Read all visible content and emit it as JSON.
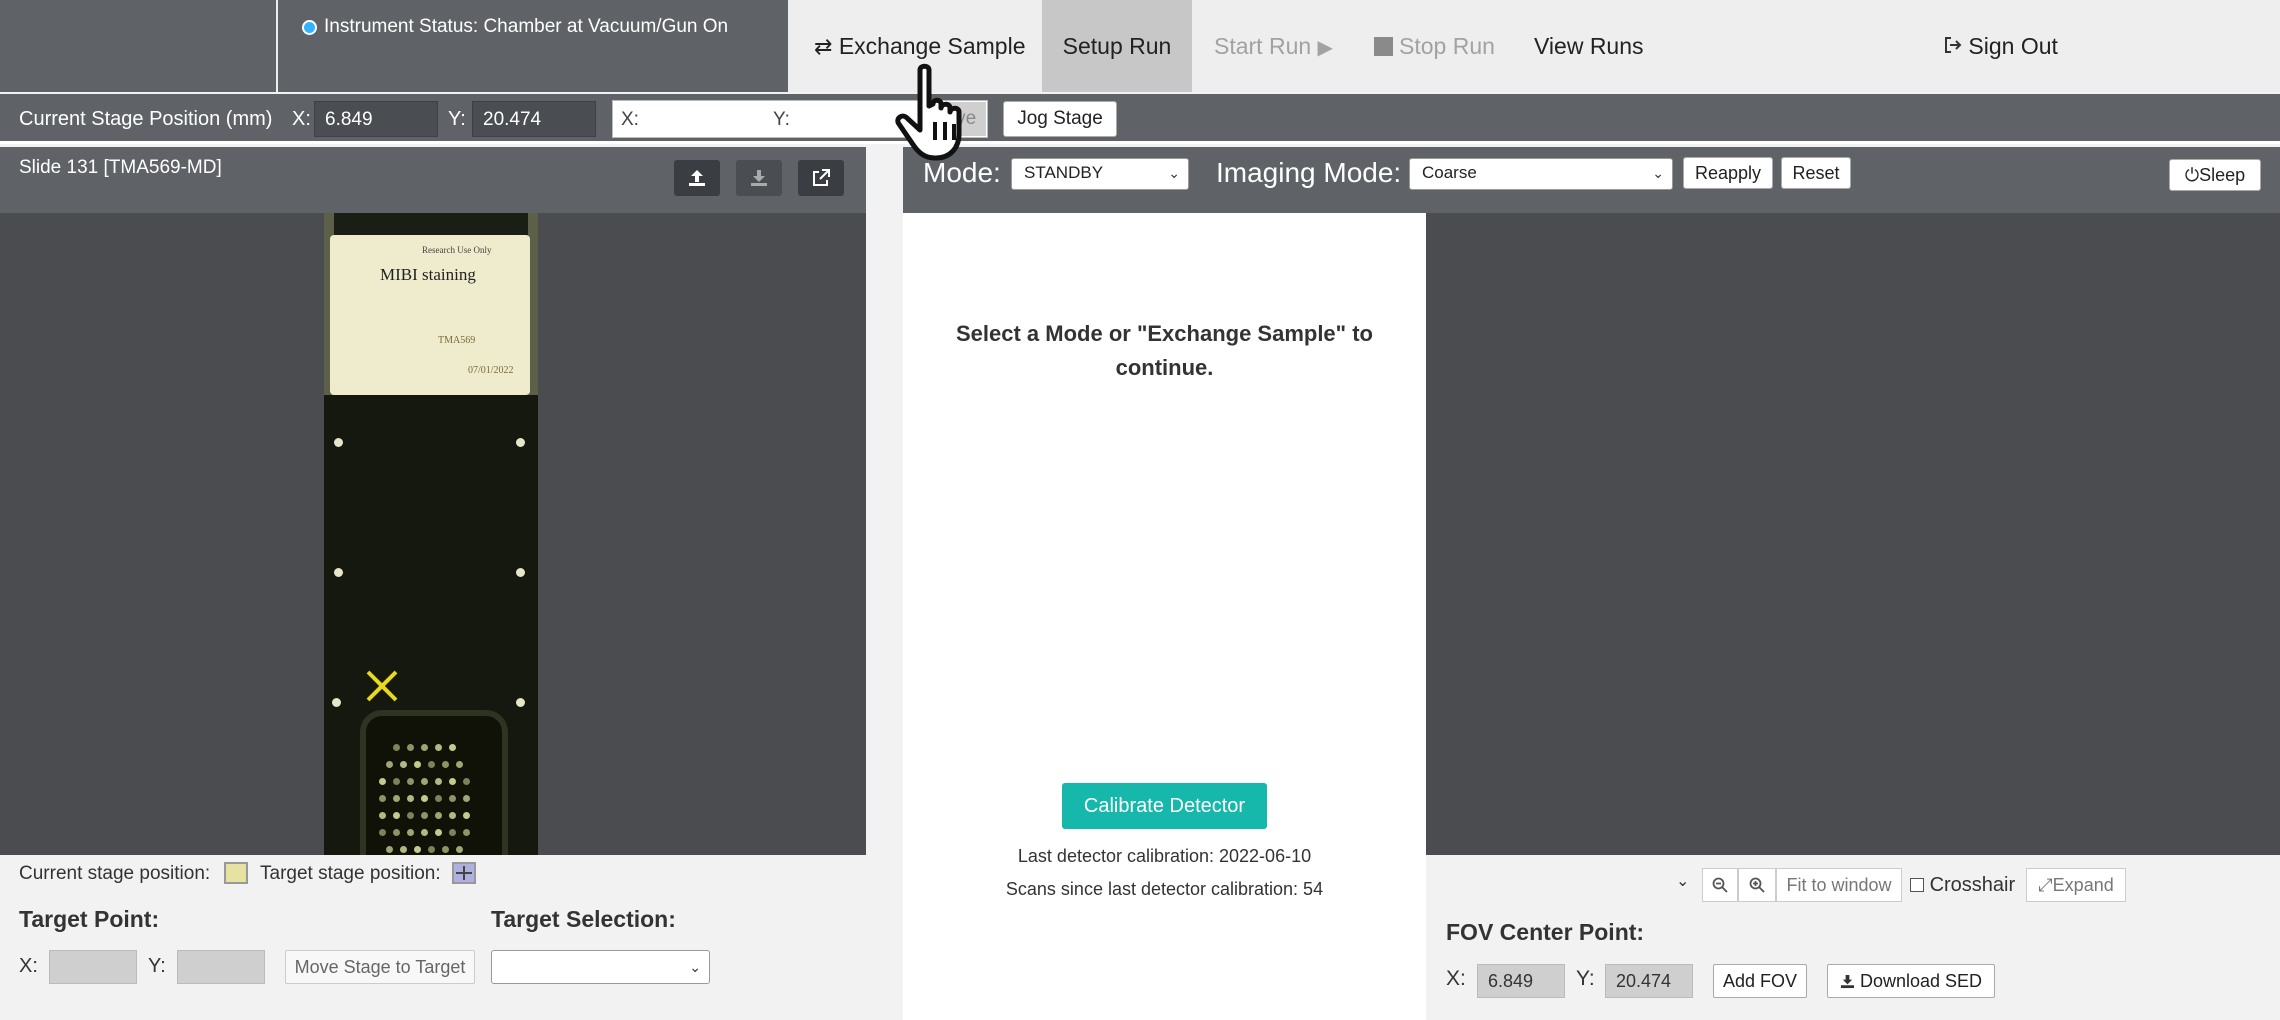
{
  "status": {
    "text": "Instrument Status: Chamber at Vacuum/Gun On",
    "indicator_color": "#32b3ff"
  },
  "nav": {
    "exchange_sample": "Exchange Sample",
    "setup_run": "Setup Run",
    "start_run": "Start Run",
    "stop_run": "Stop Run",
    "view_runs": "View Runs",
    "sign_out": "Sign Out"
  },
  "stage": {
    "label": "Current Stage Position (mm)",
    "x_label": "X:",
    "y_label": "Y:",
    "x_value": "6.849",
    "y_value": "20.474",
    "target_x_label": "X:",
    "target_y_label": "Y:",
    "move_label": "Move",
    "jog_label": "Jog Stage"
  },
  "slide_panel": {
    "title": "Slide 131 [TMA569-MD]",
    "photo_text": {
      "research": "Research Use Only",
      "heading": "MIBI staining",
      "code": "TMA569",
      "date": "07/01/2022"
    },
    "legend_current": "Current stage position:",
    "legend_target": "Target stage position:",
    "target_point_heading": "Target Point:",
    "target_x_label": "X:",
    "target_y_label": "Y:",
    "move_to_target": "Move Stage to Target",
    "target_selection_heading": "Target Selection:",
    "target_selection_value": ""
  },
  "mode_bar": {
    "mode_label": "Mode:",
    "mode_value": "STANDBY",
    "imaging_label": "Imaging Mode:",
    "imaging_value": "Coarse",
    "reapply": "Reapply",
    "reset": "Reset",
    "sleep": "Sleep"
  },
  "center": {
    "message": "Select a Mode or \"Exchange Sample\" to continue.",
    "calibrate": "Calibrate Detector",
    "last_calibration": "Last detector calibration: 2022-06-10",
    "scans_since": "Scans since last detector calibration: 54"
  },
  "fov": {
    "fit_window": "Fit to window",
    "crosshair": "Crosshair",
    "expand": "Expand",
    "heading": "FOV Center Point:",
    "x_label": "X:",
    "y_label": "Y:",
    "x_value": "6.849",
    "y_value": "20.474",
    "add_fov": "Add FOV",
    "download_sed": "Download SED"
  },
  "colors": {
    "panel_dark": "#5f6266",
    "view_bg": "#4a4c50",
    "accent": "#15b8ab"
  },
  "icons": [
    "status-dot-icon",
    "exchange-arrows-icon",
    "play-icon",
    "stop-icon",
    "sign-out-icon",
    "upload-icon",
    "download-icon",
    "external-link-icon",
    "power-icon",
    "zoom-out-icon",
    "zoom-in-icon",
    "expand-icon",
    "hand-cursor-icon"
  ]
}
